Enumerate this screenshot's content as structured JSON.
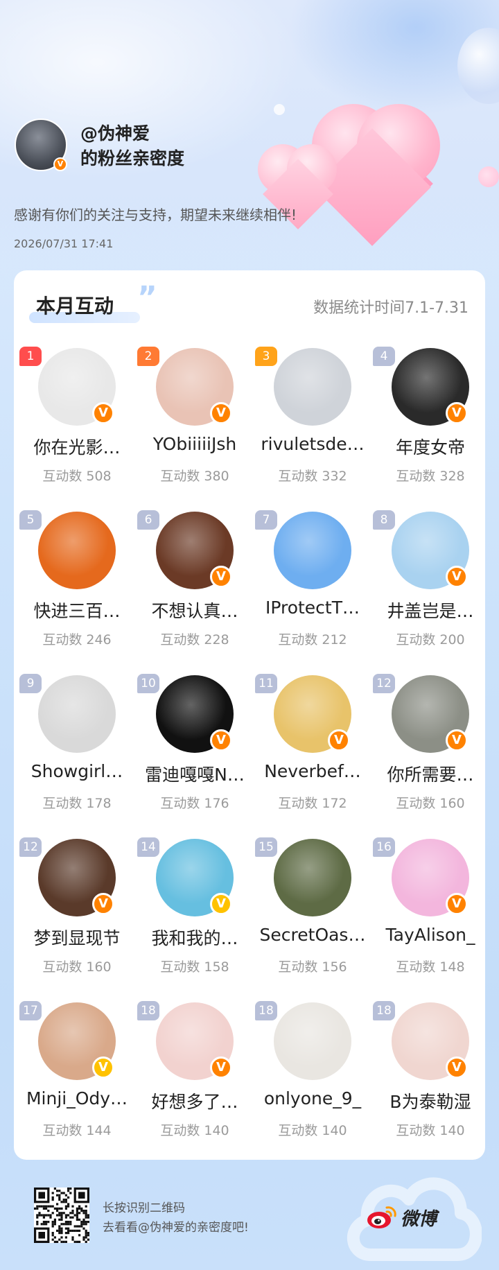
{
  "header": {
    "title_line1": "@伪神爱",
    "title_line2": "的粉丝亲密度",
    "verified_mark": "V",
    "message": "感谢有你们的关注与支持，期望未来继续相伴!",
    "datetime": "2026/07/31  17:41"
  },
  "section": {
    "title": "本月互动",
    "quote": "”",
    "period": "数据统计时间7.1-7.31"
  },
  "fans": [
    {
      "rank": "1",
      "name": "你在光影…",
      "count": "互动数 508",
      "badge": "V",
      "color": "#e8e8e8"
    },
    {
      "rank": "2",
      "name": "YObiiiiiJsh",
      "count": "互动数 380",
      "badge": "V",
      "color": "#e9c3b5"
    },
    {
      "rank": "3",
      "name": "rivuletsde…",
      "count": "互动数 332",
      "badge": "",
      "color": "#cfd3d9"
    },
    {
      "rank": "4",
      "name": "年度女帝",
      "count": "互动数 328",
      "badge": "V",
      "color": "#2a2a2a"
    },
    {
      "rank": "5",
      "name": "快进三百…",
      "count": "互动数 246",
      "badge": "",
      "color": "#e5691d"
    },
    {
      "rank": "6",
      "name": "不想认真…",
      "count": "互动数 228",
      "badge": "V",
      "color": "#6b3a26"
    },
    {
      "rank": "7",
      "name": "IProtectT…",
      "count": "互动数 212",
      "badge": "",
      "color": "#6eaef0"
    },
    {
      "rank": "8",
      "name": "井盖岂是…",
      "count": "互动数 200",
      "badge": "V",
      "color": "#a9d2f0"
    },
    {
      "rank": "9",
      "name": "Showgirl…",
      "count": "互动数 178",
      "badge": "",
      "color": "#d9d9d9"
    },
    {
      "rank": "10",
      "name": "雷迪嘎嘎N…",
      "count": "互动数 176",
      "badge": "V",
      "color": "#111111"
    },
    {
      "rank": "11",
      "name": "Neverbef…",
      "count": "互动数 172",
      "badge": "V",
      "color": "#e8c36a"
    },
    {
      "rank": "12",
      "name": "你所需要…",
      "count": "互动数 160",
      "badge": "V",
      "color": "#8c8f86"
    },
    {
      "rank": "12",
      "name": "梦到显现节",
      "count": "互动数 160",
      "badge": "V",
      "color": "#5a3a2a"
    },
    {
      "rank": "14",
      "name": "我和我的…",
      "count": "互动数 158",
      "badge": "V",
      "color": "#66bfe0"
    },
    {
      "rank": "15",
      "name": "SecretOas…",
      "count": "互动数 156",
      "badge": "",
      "color": "#5e6b45"
    },
    {
      "rank": "16",
      "name": "TayAlison_",
      "count": "互动数 148",
      "badge": "V",
      "color": "#f3b6dd"
    },
    {
      "rank": "17",
      "name": "Minji_Ody…",
      "count": "互动数 144",
      "badge": "V",
      "color": "#d9a98a"
    },
    {
      "rank": "18",
      "name": "好想多了…",
      "count": "互动数 140",
      "badge": "V",
      "color": "#f2d2cf"
    },
    {
      "rank": "18",
      "name": "onlyone_9_",
      "count": "互动数 140",
      "badge": "",
      "color": "#e9e6e1"
    },
    {
      "rank": "18",
      "name": "B为泰勒湿",
      "count": "互动数 140",
      "badge": "V",
      "color": "#f0d6d0"
    }
  ],
  "footer": {
    "line1": "长按识别二维码",
    "line2": "去看看@伪神爱的亲密度吧!",
    "brand": "微博"
  }
}
